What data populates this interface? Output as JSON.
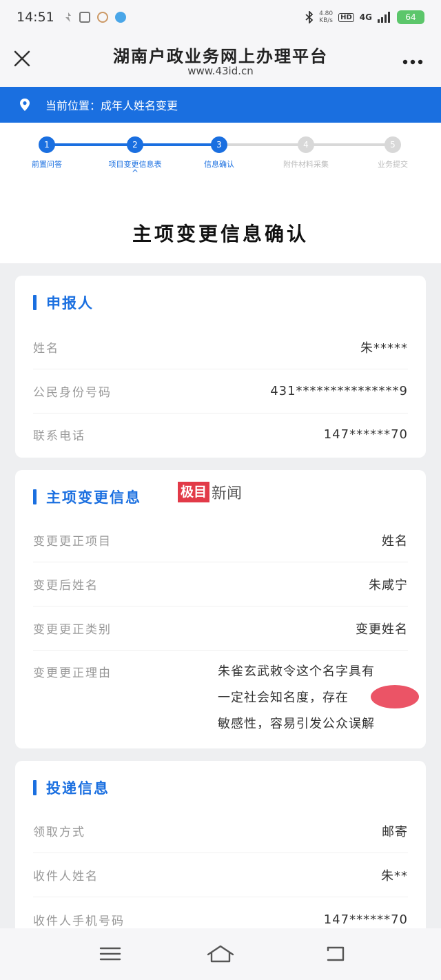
{
  "status_bar": {
    "time": "14:51",
    "net_speed_value": "4.80",
    "net_speed_unit": "KB/s",
    "hd": "HD",
    "signal": "4G",
    "battery": "64"
  },
  "header": {
    "title": "湖南户政业务网上办理平台",
    "url": "www.43id.cn",
    "close_icon": "close-icon",
    "more_icon": "more-icon"
  },
  "location": {
    "label": "当前位置：成年人姓名变更"
  },
  "steps": [
    {
      "number": "1",
      "label": "前置问答",
      "state": "done"
    },
    {
      "number": "2",
      "label": "项目变更信息表",
      "state": "done"
    },
    {
      "number": "3",
      "label": "信息确认",
      "state": "active"
    },
    {
      "number": "4",
      "label": "附件材料采集",
      "state": "pending"
    },
    {
      "number": "5",
      "label": "业务提交",
      "state": "pending"
    }
  ],
  "step_caret": "^",
  "page_title": "主项变更信息确认",
  "applicant": {
    "section_title": "申报人",
    "rows": [
      {
        "label": "姓名",
        "value": "朱*****"
      },
      {
        "label": "公民身份号码",
        "value": "431***************9"
      },
      {
        "label": "联系电话",
        "value": "147******70"
      }
    ]
  },
  "change_info": {
    "section_title": "主项变更信息",
    "rows": [
      {
        "label": "变更更正项目",
        "value": "姓名"
      },
      {
        "label": "变更后姓名",
        "value": "朱咸宁"
      },
      {
        "label": "变更更正类别",
        "value": "变更姓名"
      }
    ],
    "reason_label": "变更更正理由",
    "reason_lines": [
      "朱雀玄武敕令这个名字具有",
      "一定社会知名度，存在",
      "敏感性，容易引发公众误解"
    ]
  },
  "delivery": {
    "section_title": "投递信息",
    "rows": [
      {
        "label": "领取方式",
        "value": "邮寄"
      },
      {
        "label": "收件人姓名",
        "value": "朱**"
      },
      {
        "label": "收件人手机号码",
        "value": "147******70"
      }
    ]
  },
  "watermark": {
    "box": "极目",
    "text": "新闻"
  },
  "nav": {
    "menu_icon": "menu-icon",
    "home_icon": "home-icon",
    "back_icon": "back-icon"
  },
  "colors": {
    "primary": "#1a6fe0",
    "step_pending": "#d8d8d8",
    "redaction": "#e8364b"
  }
}
